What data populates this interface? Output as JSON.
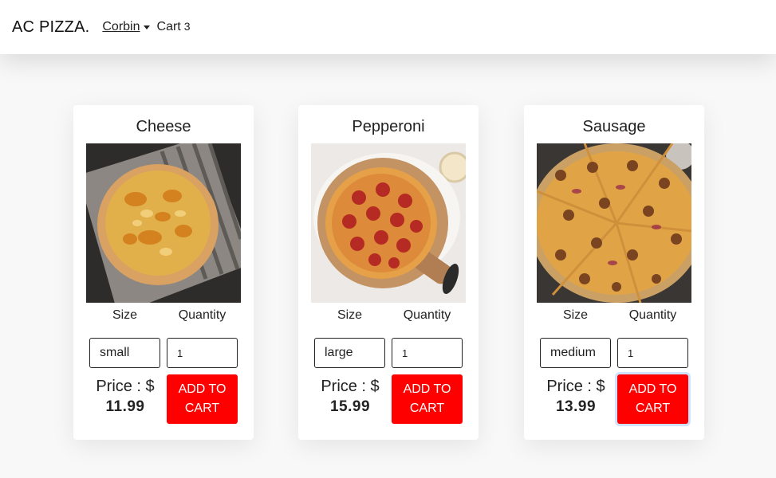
{
  "navbar": {
    "brand": "AC PIZZA.",
    "user": "Corbin",
    "cart_label": "Cart",
    "cart_count": "3"
  },
  "products": [
    {
      "name": "Cheese",
      "size_label": "Size",
      "quantity_label": "Quantity",
      "size": "small",
      "quantity": "1",
      "price_label": "Price : $",
      "price": "11.99",
      "add_label": "ADD TO CART"
    },
    {
      "name": "Pepperoni",
      "size_label": "Size",
      "quantity_label": "Quantity",
      "size": "large",
      "quantity": "1",
      "price_label": "Price : $",
      "price": "15.99",
      "add_label": "ADD TO CART"
    },
    {
      "name": "Sausage",
      "size_label": "Size",
      "quantity_label": "Quantity",
      "size": "medium",
      "quantity": "1",
      "price_label": "Price : $",
      "price": "13.99",
      "add_label": "ADD TO CART"
    }
  ],
  "colors": {
    "accent": "#ff0000",
    "background": "#f8f8f8"
  }
}
